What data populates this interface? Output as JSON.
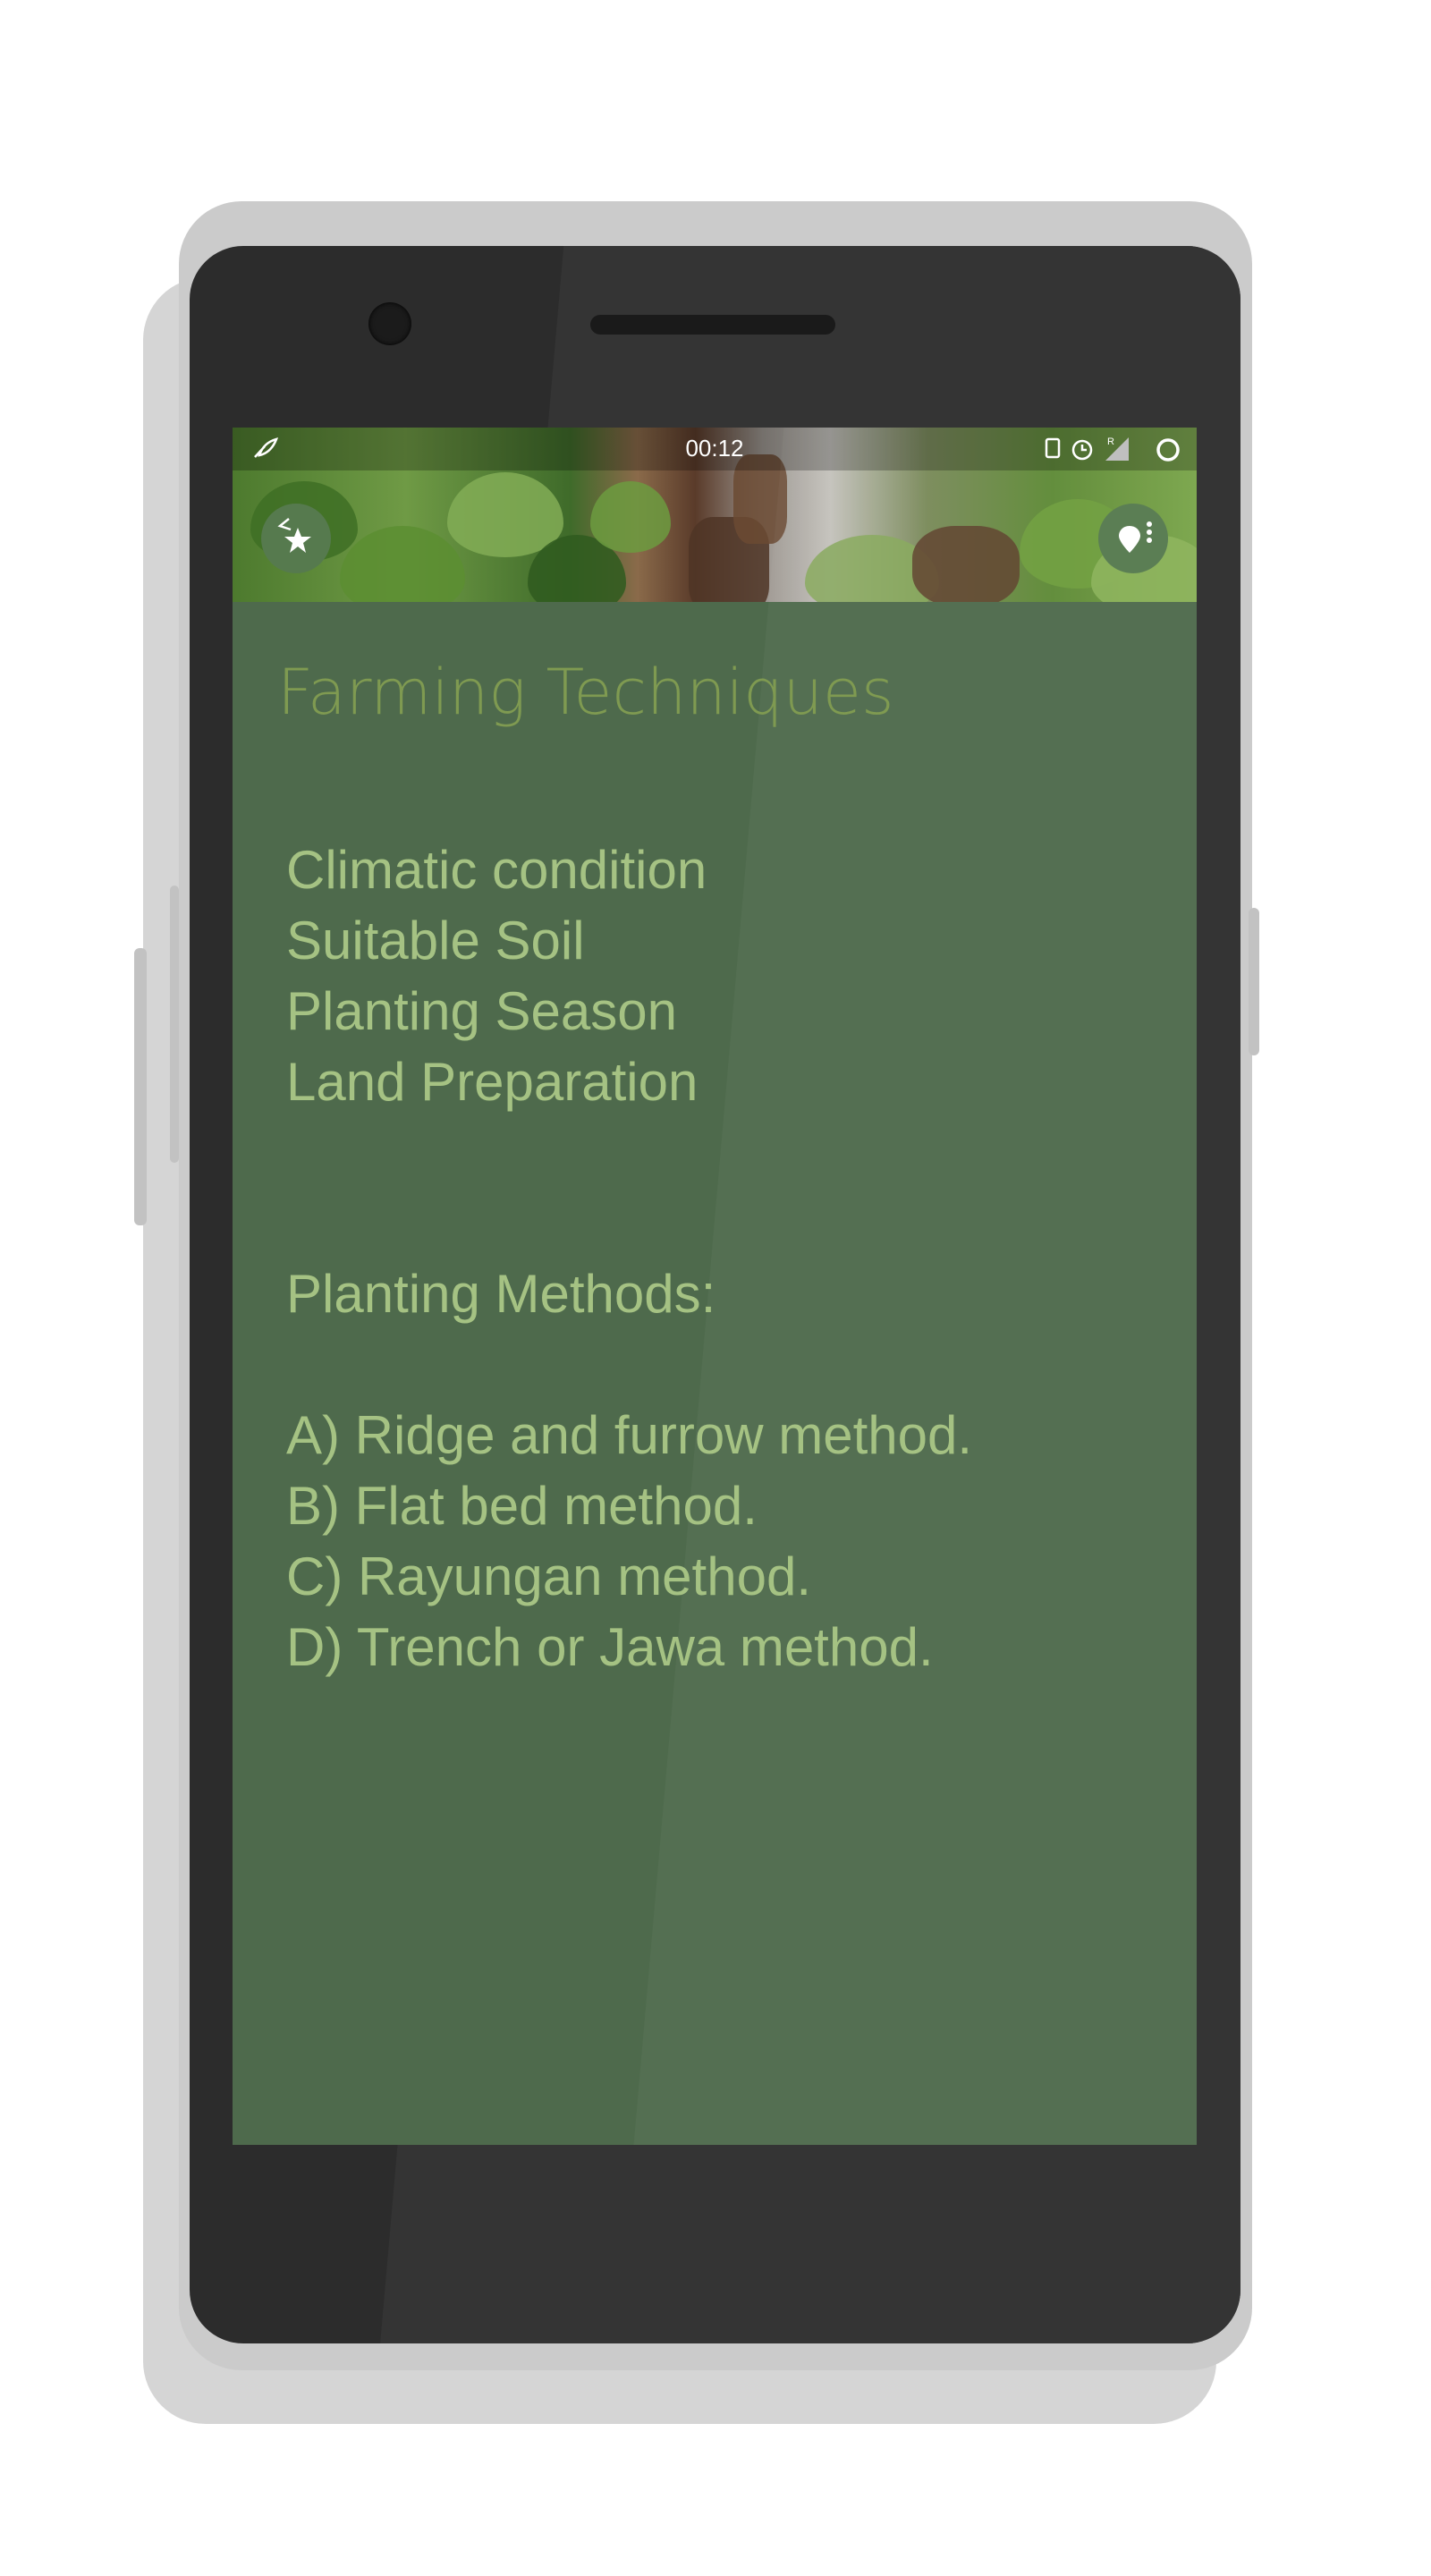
{
  "status_bar": {
    "time": "00:12"
  },
  "header": {
    "left_button_icon": "star-share-icon",
    "right_button_icon": "location-pin-menu-icon"
  },
  "page": {
    "title": "Farming Techniques"
  },
  "topics": [
    {
      "label": "Climatic condition"
    },
    {
      "label": "Suitable Soil"
    },
    {
      "label": "Planting Season"
    },
    {
      "label": "Land Preparation"
    }
  ],
  "methods": {
    "heading": "Planting Methods:",
    "items": [
      {
        "label": "A) Ridge and furrow method."
      },
      {
        "label": "B) Flat bed method."
      },
      {
        "label": "C) Rayungan method."
      },
      {
        "label": "D) Trench or Jawa method."
      }
    ]
  },
  "colors": {
    "screen_background": "#4e6a4c",
    "title_color": "#7f9a51",
    "text_color": "#a5c283"
  }
}
